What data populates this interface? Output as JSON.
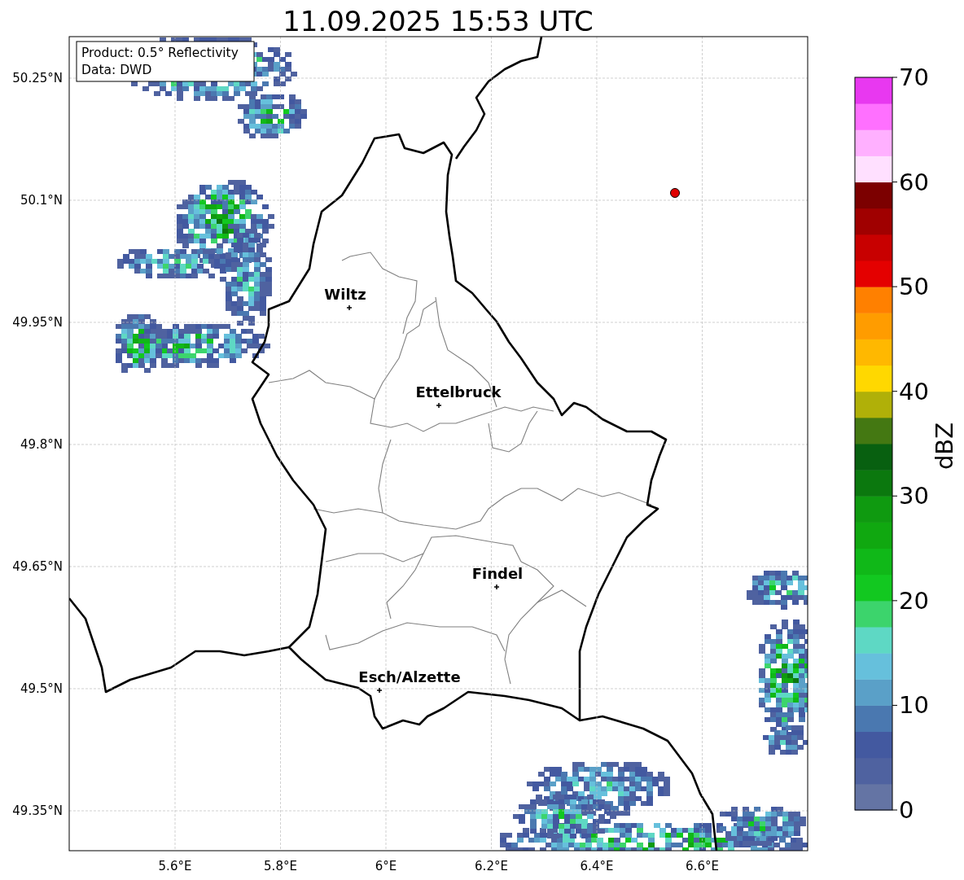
{
  "title": "11.09.2025 15:53 UTC",
  "legend": [
    "Product: 0.5° Reflectivity",
    "Data: DWD"
  ],
  "lat_ticks": [
    "50.25°N",
    "50.1°N",
    "49.95°N",
    "49.8°N",
    "49.65°N",
    "49.5°N",
    "49.35°N"
  ],
  "lon_ticks": [
    "5.6°E",
    "5.8°E",
    "6°E",
    "6.2°E",
    "6.4°E",
    "6.6°E"
  ],
  "cities": [
    {
      "name": "Wiltz"
    },
    {
      "name": "Ettelbruck"
    },
    {
      "name": "Findel"
    },
    {
      "name": "Esch/Alzette"
    }
  ],
  "colorbar": {
    "label": "dBZ",
    "ticks": [
      "70",
      "60",
      "50",
      "40",
      "30",
      "20",
      "10",
      "0"
    ],
    "bands": [
      {
        "color": "#6474a4"
      },
      {
        "color": "#4f62a0"
      },
      {
        "color": "#4359a0"
      },
      {
        "color": "#4a78b0"
      },
      {
        "color": "#5aa0c8"
      },
      {
        "color": "#66c0dc"
      },
      {
        "color": "#5ed8c4"
      },
      {
        "color": "#3cd46c"
      },
      {
        "color": "#12c820"
      },
      {
        "color": "#10b818"
      },
      {
        "color": "#10a810"
      },
      {
        "color": "#0f9a10"
      },
      {
        "color": "#0b780e"
      },
      {
        "color": "#086010"
      },
      {
        "color": "#447812"
      },
      {
        "color": "#b0b008"
      },
      {
        "color": "#ffd800"
      },
      {
        "color": "#ffb800"
      },
      {
        "color": "#ff9c00"
      },
      {
        "color": "#ff8000"
      },
      {
        "color": "#e40000"
      },
      {
        "color": "#c80000"
      },
      {
        "color": "#a00000"
      },
      {
        "color": "#7c0000"
      },
      {
        "color": "#ffe0ff"
      },
      {
        "color": "#ffb0ff"
      },
      {
        "color": "#ff70ff"
      },
      {
        "color": "#e838f0"
      }
    ]
  }
}
